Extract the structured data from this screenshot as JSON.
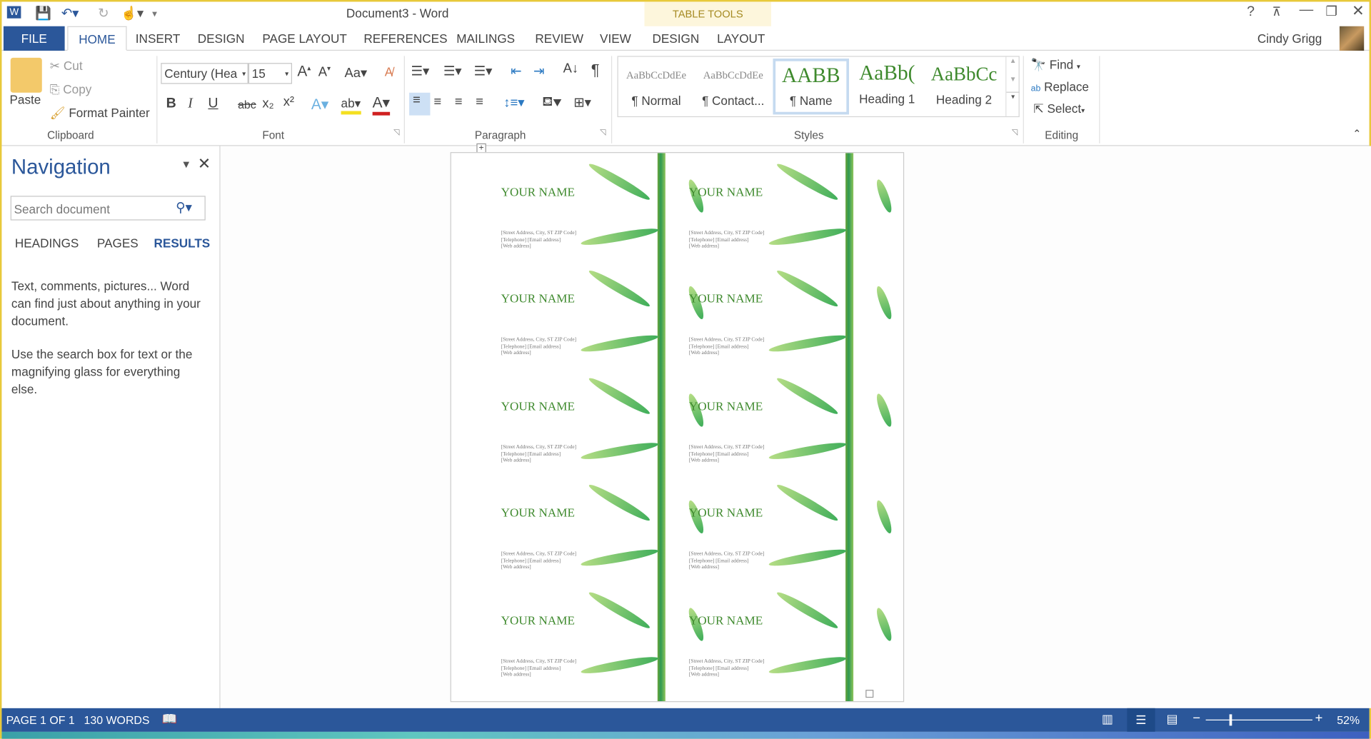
{
  "window": {
    "title": "Document3 - Word",
    "context_tab": "TABLE TOOLS",
    "user": "Cindy Grigg",
    "controls": [
      "?",
      "restore-ribbon",
      "minimize",
      "maximize",
      "close"
    ]
  },
  "tabs": [
    "FILE",
    "HOME",
    "INSERT",
    "DESIGN",
    "PAGE LAYOUT",
    "REFERENCES",
    "MAILINGS",
    "REVIEW",
    "VIEW",
    "DESIGN",
    "LAYOUT"
  ],
  "clipboard": {
    "paste": "Paste",
    "cut": "Cut",
    "copy": "Copy",
    "format_painter": "Format Painter",
    "label": "Clipboard"
  },
  "font": {
    "name": "Century (Hea",
    "size": "15",
    "label": "Font",
    "bold": "B",
    "italic": "I",
    "underline": "U",
    "strike": "abc",
    "sub": "x₂",
    "sup": "x²",
    "change_case": "Aa"
  },
  "paragraph": {
    "label": "Paragraph"
  },
  "styles": {
    "label": "Styles",
    "items": [
      {
        "preview": "AaBbCcDdEe",
        "label": "¶ Normal"
      },
      {
        "preview": "AaBbCcDdEe",
        "label": "¶ Contact..."
      },
      {
        "preview": "AABB",
        "label": "¶ Name",
        "selected": true
      },
      {
        "preview": "AaBb(",
        "label": "Heading 1"
      },
      {
        "preview": "AaBbCc",
        "label": "Heading 2"
      }
    ]
  },
  "editing": {
    "label": "Editing",
    "find": "Find",
    "replace": "Replace",
    "select": "Select"
  },
  "navigation": {
    "title": "Navigation",
    "search_placeholder": "Search document",
    "tabs": [
      "HEADINGS",
      "PAGES",
      "RESULTS"
    ],
    "active_tab": "RESULTS",
    "help1": "Text, comments, pictures... Word can find just about anything in your document.",
    "help2": "Use the search box for text or the magnifying glass for everything else."
  },
  "cards": {
    "name": "YOUR NAME",
    "address": "[Street Address, City, ST  ZIP Code]",
    "phone_email": "[Telephone]  [Email address]",
    "web": "[Web address]"
  },
  "status": {
    "page": "PAGE 1 OF 1",
    "words": "130 WORDS",
    "zoom": "52%",
    "zoom_level": 52
  },
  "colors": {
    "accent": "#2b579a",
    "name_green": "#3f8a2e",
    "window_border": "#e8c93a"
  }
}
